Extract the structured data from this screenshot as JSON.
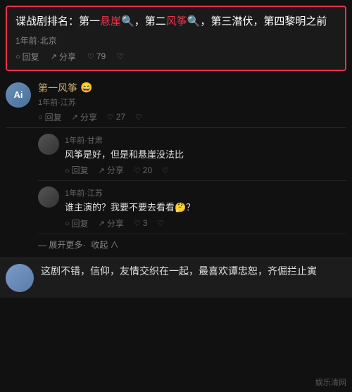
{
  "topComment": {
    "text": "谍战剧排名：第一悬崖，第二风筝，第三潜伏，第四黎明之前",
    "highlight1": "悬崖",
    "highlight2": "风筝",
    "meta": "1年前·北京",
    "replyLabel": "回复",
    "shareLabel": "分享",
    "likeCount": "79"
  },
  "comments": [
    {
      "id": "c1",
      "username": "第一风筝",
      "emoji": "😄",
      "location": "1年前·江苏",
      "text": "",
      "replyLabel": "回复",
      "shareLabel": "分享",
      "likeCount": "27",
      "avatarLabel": "Ai",
      "replies": []
    },
    {
      "id": "c2",
      "username": "",
      "location": "1年前·甘肃",
      "text": "风筝是好，但是和悬崖没法比",
      "replyLabel": "回复",
      "shareLabel": "分享",
      "likeCount": "20",
      "replies": []
    },
    {
      "id": "c3",
      "username": "",
      "location": "1年前·江苏",
      "text": "谁主演的？我要不要去看看🤔？",
      "replyLabel": "回复",
      "shareLabel": "分享",
      "likeCount": "3",
      "replies": []
    }
  ],
  "expandMore": {
    "expandLabel": "展开更多·",
    "collapseLabel": "收起 ∧"
  },
  "bottomComment": {
    "text": "这剧不错，信仰，友情交织在一起，最喜欢谭忠恕，齐倔拦止寅",
    "highlightName": "齐倔拦止寅"
  },
  "watermark": {
    "text": "娱乐清网"
  }
}
